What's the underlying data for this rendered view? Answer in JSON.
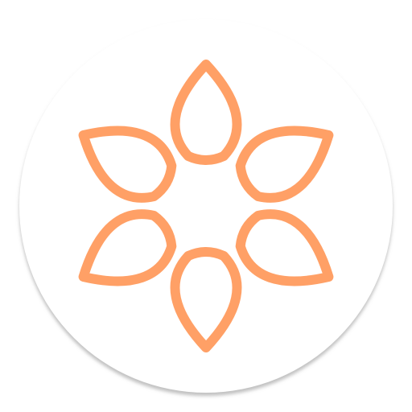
{
  "app_icon": {
    "icon": "flower-icon",
    "petal_count": 6,
    "colors": {
      "background": "#ffffff",
      "badge_fill": "#ffffff",
      "badge_shadow": "#c8c8c8",
      "gradient_top": "#ffa066",
      "gradient_mid": "#ff7a5c",
      "gradient_bottom": "#ff4a52"
    }
  }
}
